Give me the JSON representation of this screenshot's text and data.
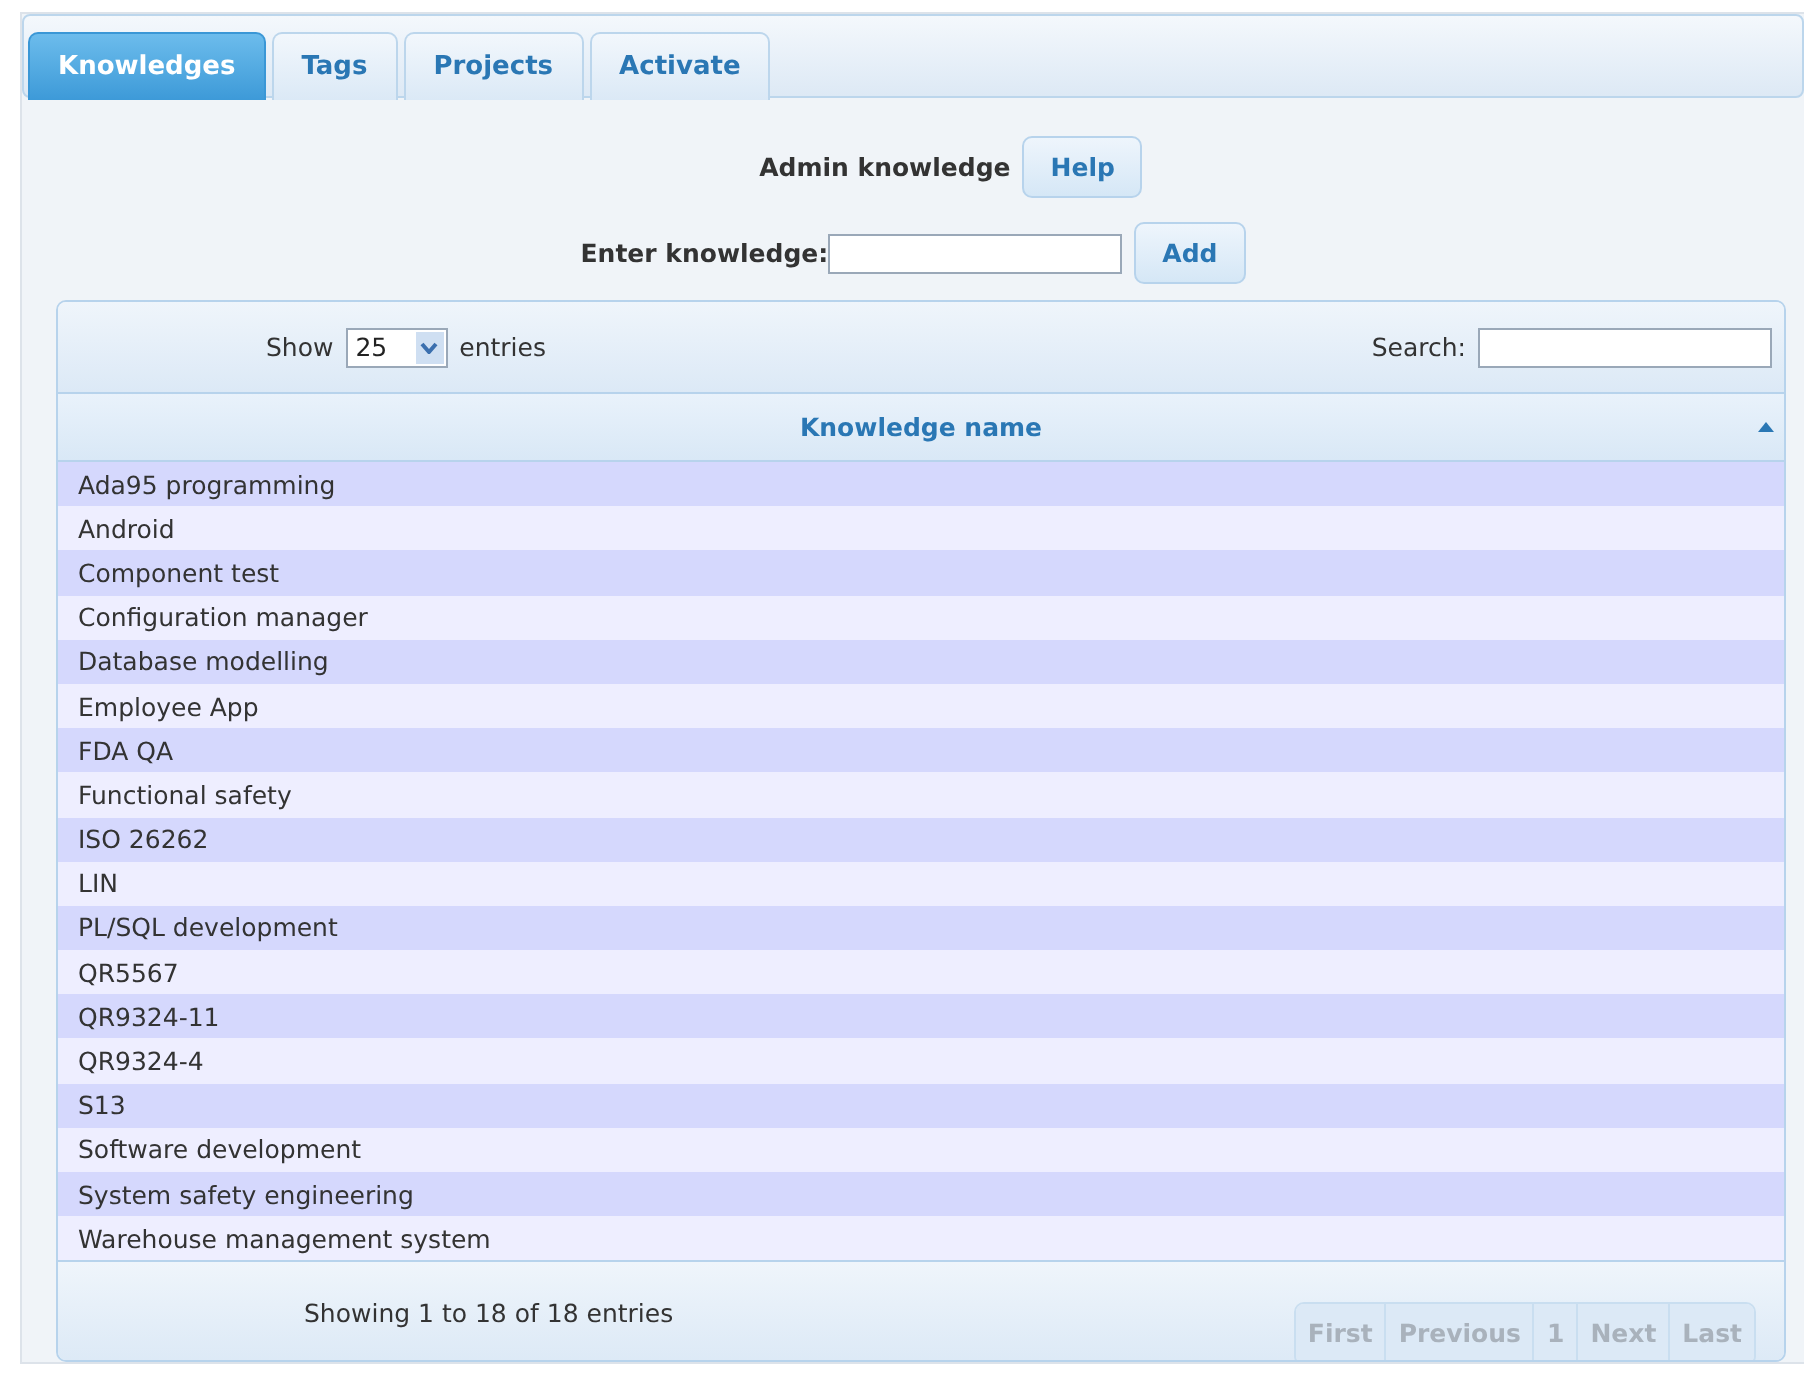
{
  "tabs": [
    {
      "label": "Knowledges",
      "selected": true
    },
    {
      "label": "Tags",
      "selected": false
    },
    {
      "label": "Projects",
      "selected": false
    },
    {
      "label": "Activate",
      "selected": false
    }
  ],
  "header": {
    "title": "Admin knowledge",
    "help_button": "Help"
  },
  "add_form": {
    "label": "Enter knowledge:",
    "button": "Add"
  },
  "table": {
    "length_label_before": "Show",
    "length_value": "25",
    "length_label_after": "entries",
    "search_label": "Search:",
    "columns": [
      {
        "label": "Knowledge name",
        "sorted": true
      }
    ],
    "rows": [
      "Ada95 programming",
      "Android",
      "Component test",
      "Configuration manager",
      "Database modelling",
      "Employee App",
      "FDA QA",
      "Functional safety",
      "ISO 26262",
      "LIN",
      "PL/SQL development",
      "QR5567",
      "QR9324-11",
      "QR9324-4",
      "S13",
      "Software development",
      "System safety engineering",
      "Warehouse management system"
    ],
    "info": "Showing 1 to 18 of 18 entries",
    "pager": [
      {
        "label": "First",
        "disabled": true
      },
      {
        "label": "Previous",
        "disabled": true
      },
      {
        "label": "1",
        "disabled": true
      },
      {
        "label": "Next",
        "disabled": true
      },
      {
        "label": "Last",
        "disabled": true
      }
    ]
  }
}
